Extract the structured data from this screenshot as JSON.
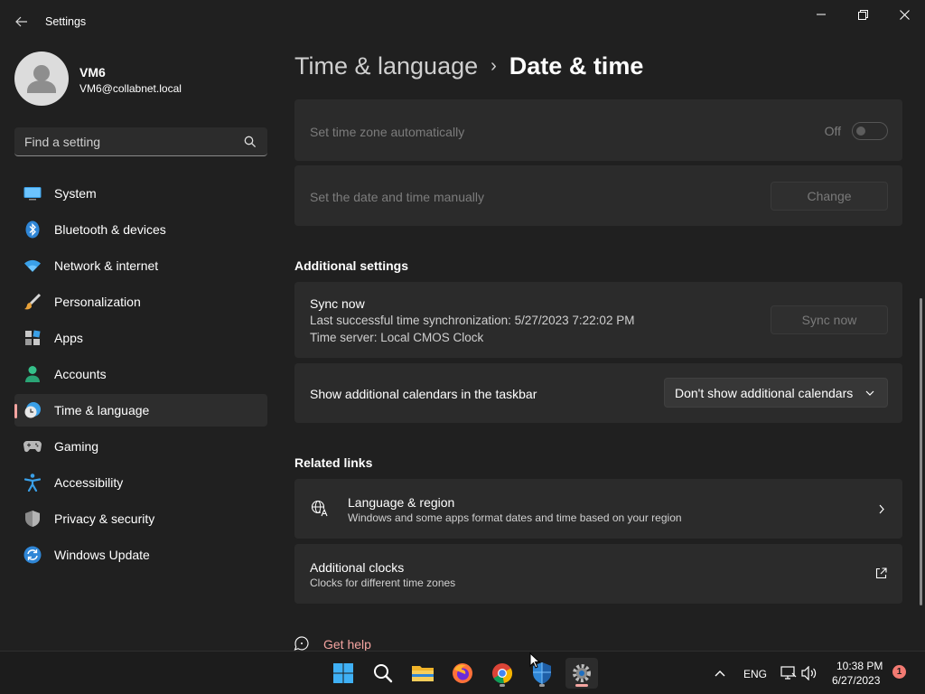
{
  "window": {
    "title": "Settings"
  },
  "profile": {
    "name": "VM6",
    "email": "VM6@collabnet.local"
  },
  "search": {
    "placeholder": "Find a setting"
  },
  "sidebar": {
    "items": [
      {
        "label": "System",
        "icon": "system-icon"
      },
      {
        "label": "Bluetooth & devices",
        "icon": "bluetooth-icon"
      },
      {
        "label": "Network & internet",
        "icon": "wifi-icon"
      },
      {
        "label": "Personalization",
        "icon": "brush-icon"
      },
      {
        "label": "Apps",
        "icon": "apps-icon"
      },
      {
        "label": "Accounts",
        "icon": "person-icon"
      },
      {
        "label": "Time & language",
        "icon": "clock-globe-icon",
        "active": true
      },
      {
        "label": "Gaming",
        "icon": "gamepad-icon"
      },
      {
        "label": "Accessibility",
        "icon": "accessibility-icon"
      },
      {
        "label": "Privacy & security",
        "icon": "shield-icon"
      },
      {
        "label": "Windows Update",
        "icon": "update-icon"
      }
    ]
  },
  "breadcrumb": {
    "parent": "Time & language",
    "current": "Date & time"
  },
  "settings": {
    "timezone_auto": {
      "label": "Set time zone automatically",
      "state": "Off"
    },
    "manual": {
      "label": "Set the date and time manually",
      "button": "Change"
    }
  },
  "additional": {
    "title": "Additional settings",
    "sync": {
      "title": "Sync now",
      "last_sync": "Last successful time synchronization: 5/27/2023 7:22:02 PM",
      "server": "Time server: Local CMOS Clock",
      "button": "Sync now"
    },
    "calendars": {
      "label": "Show additional calendars in the taskbar",
      "selected": "Don't show additional calendars"
    }
  },
  "related": {
    "title": "Related links",
    "language": {
      "title": "Language & region",
      "subtitle": "Windows and some apps format dates and time based on your region"
    },
    "clocks": {
      "title": "Additional clocks",
      "subtitle": "Clocks for different time zones"
    }
  },
  "help": {
    "label": "Get help"
  },
  "taskbar": {
    "apps": [
      "start-icon",
      "search-icon",
      "file-explorer-icon",
      "firefox-icon",
      "chrome-icon",
      "defender-icon",
      "settings-icon"
    ],
    "tray": {
      "language": "ENG",
      "time": "10:38 PM",
      "date": "6/27/2023",
      "notifications": "1"
    }
  },
  "colors": {
    "accent": "#f4a4a0",
    "background": "#202020",
    "card": "#2b2b2b"
  }
}
